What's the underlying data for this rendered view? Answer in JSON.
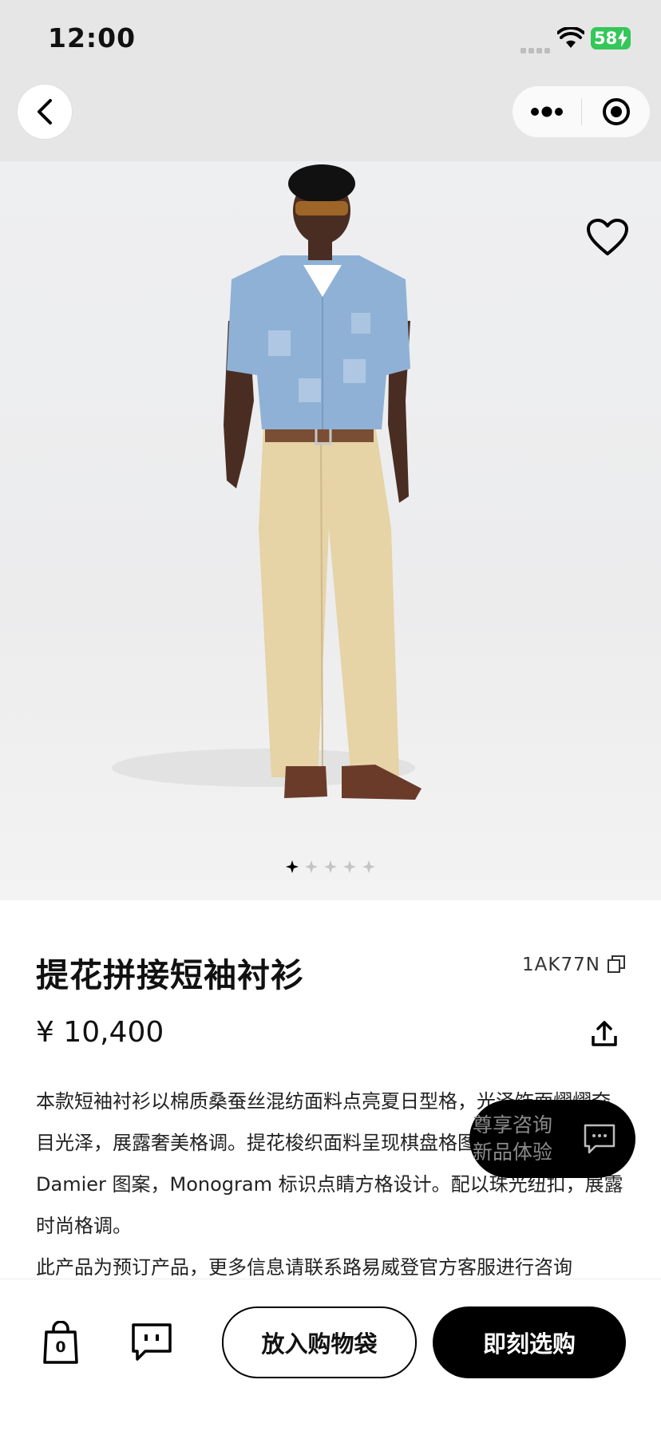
{
  "status_bar": {
    "time": "12:00",
    "battery": "58"
  },
  "gallery": {
    "dot_count": 5,
    "active_dot": 0
  },
  "product": {
    "title": "提花拼接短袖衬衫",
    "sku": "1AK77N",
    "price": "¥ 10,400",
    "description": "本款短袖衬衫以棉质桑蚕丝混纺面料点亮夏日型格，光泽饰面熠熠夺目光泽，展露奢美格调。提花梭织面料呈现棋盘格图案，致意经典 Damier 图案，Monogram 标识点睛方格设计。配以珠光纽扣，展露时尚格调。",
    "preorder_note": "此产品为预订产品，更多信息请联系路易威登官方客服进行咨询"
  },
  "float_chat": {
    "line1": "尊享咨询",
    "line2": "新品体验"
  },
  "bottom_bar": {
    "bag_count": "0",
    "add_to_bag": "放入购物袋",
    "buy_now": "即刻选购"
  },
  "colors": {
    "accent": "#000000",
    "battery": "#34c759",
    "background": "#ffffff"
  },
  "icons": [
    "back-icon",
    "more-icon",
    "close-capsule-icon",
    "heart-icon",
    "copy-icon",
    "share-icon",
    "chat-icon",
    "shopping-bag-icon",
    "message-icon"
  ]
}
